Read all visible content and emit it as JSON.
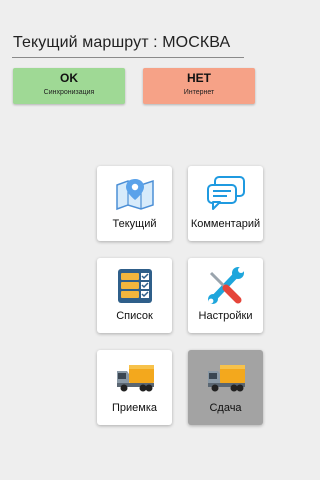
{
  "route": {
    "label": "Текущий маршрут :  МОСКВА"
  },
  "status": {
    "sync": {
      "title": "OK",
      "subtitle": "Синхронизация",
      "color": "#9fd995"
    },
    "internet": {
      "title": "НЕТ",
      "subtitle": "Интернет",
      "color": "#f6a287"
    }
  },
  "tiles": [
    {
      "label": "Текущий",
      "icon": "map-pin-icon"
    },
    {
      "label": "Комментарий",
      "icon": "chat-bubbles-icon"
    },
    {
      "label": "Список",
      "icon": "checklist-icon"
    },
    {
      "label": "Настройки",
      "icon": "wrench-screwdriver-icon"
    },
    {
      "label": "Приемка",
      "icon": "truck-icon"
    },
    {
      "label": "Сдача",
      "icon": "truck-icon",
      "selected": true
    }
  ]
}
